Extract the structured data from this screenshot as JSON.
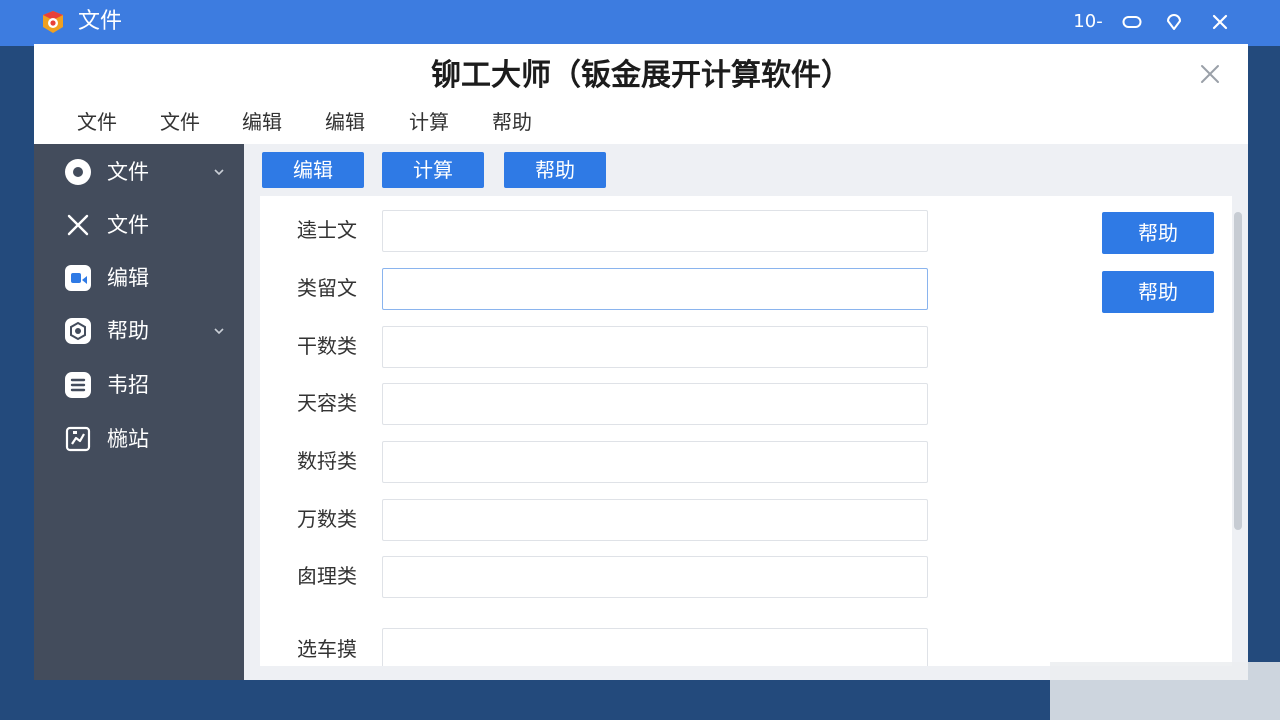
{
  "os_bar": {
    "title": "文件",
    "counter": "10-"
  },
  "window": {
    "title": "铆工大师（钣金展开计算软件）"
  },
  "menu": [
    {
      "label": "文件"
    },
    {
      "label": "文件"
    },
    {
      "label": "编辑"
    },
    {
      "label": "编辑"
    },
    {
      "label": "计算"
    },
    {
      "label": "帮助"
    }
  ],
  "sidebar": {
    "items": [
      {
        "label": "文件",
        "icon": "record-icon",
        "has_chevron": true
      },
      {
        "label": "文件",
        "icon": "close-x-icon",
        "has_chevron": false
      },
      {
        "label": "编辑",
        "icon": "edit-icon",
        "has_chevron": false
      },
      {
        "label": "帮助",
        "icon": "settings-icon",
        "has_chevron": true
      },
      {
        "label": "韦招",
        "icon": "list-icon",
        "has_chevron": false
      },
      {
        "label": "椸站",
        "icon": "chart-icon",
        "has_chevron": false
      }
    ]
  },
  "toolbar": {
    "buttons": [
      {
        "label": "编辑"
      },
      {
        "label": "计算"
      },
      {
        "label": "帮助"
      }
    ]
  },
  "form": {
    "fields": [
      {
        "label": "逵士文",
        "value": ""
      },
      {
        "label": "类留文",
        "value": ""
      },
      {
        "label": "干数类",
        "value": ""
      },
      {
        "label": "天容类",
        "value": ""
      },
      {
        "label": "数捋类",
        "value": ""
      },
      {
        "label": "万数类",
        "value": ""
      },
      {
        "label": "囱理类",
        "value": ""
      },
      {
        "label": "选车摸",
        "value": ""
      }
    ],
    "side_buttons": [
      {
        "label": "帮助"
      },
      {
        "label": "帮助"
      }
    ]
  },
  "colors": {
    "os_bar": "#3d7ce0",
    "sidebar": "#434c5c",
    "accent": "#2f7ae5",
    "content_bg": "#eef0f4"
  }
}
